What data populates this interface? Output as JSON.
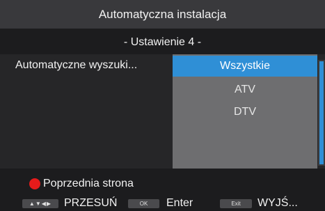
{
  "header": {
    "title": "Automatyczna instalacja",
    "subtitle": "- Ustawienie 4 -"
  },
  "setting": {
    "label": "Automatyczne wyszuki...",
    "options": [
      "Wszystkie",
      "ATV",
      "DTV"
    ],
    "selected_index": 0
  },
  "footer": {
    "red_button_label": "Poprzednia strona",
    "hints": {
      "move_keys": "▲▼◀▶",
      "move_label": "PRZESUŃ",
      "ok_key": "OK",
      "ok_label": "Enter",
      "exit_key": "Exit",
      "exit_label": "WYJŚ..."
    }
  },
  "colors": {
    "highlight": "#2f8fd6",
    "red_button": "#e51b1b",
    "dropdown_bg": "#6e6e70",
    "title_bar_bg": "#39393c"
  }
}
